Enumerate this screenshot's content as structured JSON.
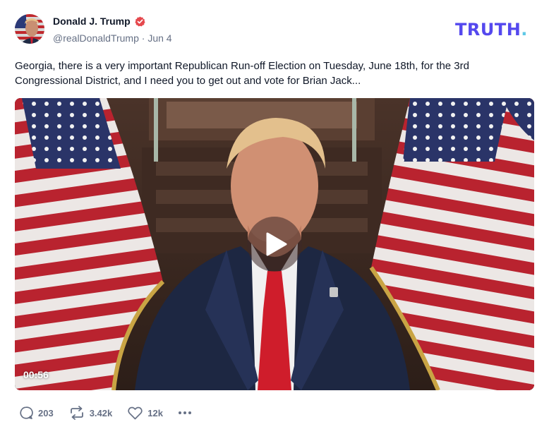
{
  "author": {
    "display_name": "Donald J. Trump",
    "handle": "@realDonaldTrump",
    "separator": "·",
    "date": "Jun 4",
    "verified_icon": "verified-badge-icon"
  },
  "brand": {
    "logo_text": "TRUTH",
    "logo_dot": ".",
    "color": "#5448ee",
    "dot_color": "#5ec8e6"
  },
  "post": {
    "text": "Georgia, there is a very important Republican Run-off Election on Tuesday, June 18th, for the 3rd Congressional District, and I need you to get out and vote for Brian Jack..."
  },
  "video": {
    "duration": "00:56",
    "play_icon": "play-icon"
  },
  "actions": {
    "replies": {
      "icon": "reply-icon",
      "count": "203"
    },
    "retruths": {
      "icon": "retruth-icon",
      "count": "3.42k"
    },
    "likes": {
      "icon": "heart-icon",
      "count": "12k"
    },
    "more": {
      "icon": "more-dots-icon"
    }
  },
  "colors": {
    "text": "#101828",
    "muted": "#667085",
    "verified": "#e5484d"
  }
}
